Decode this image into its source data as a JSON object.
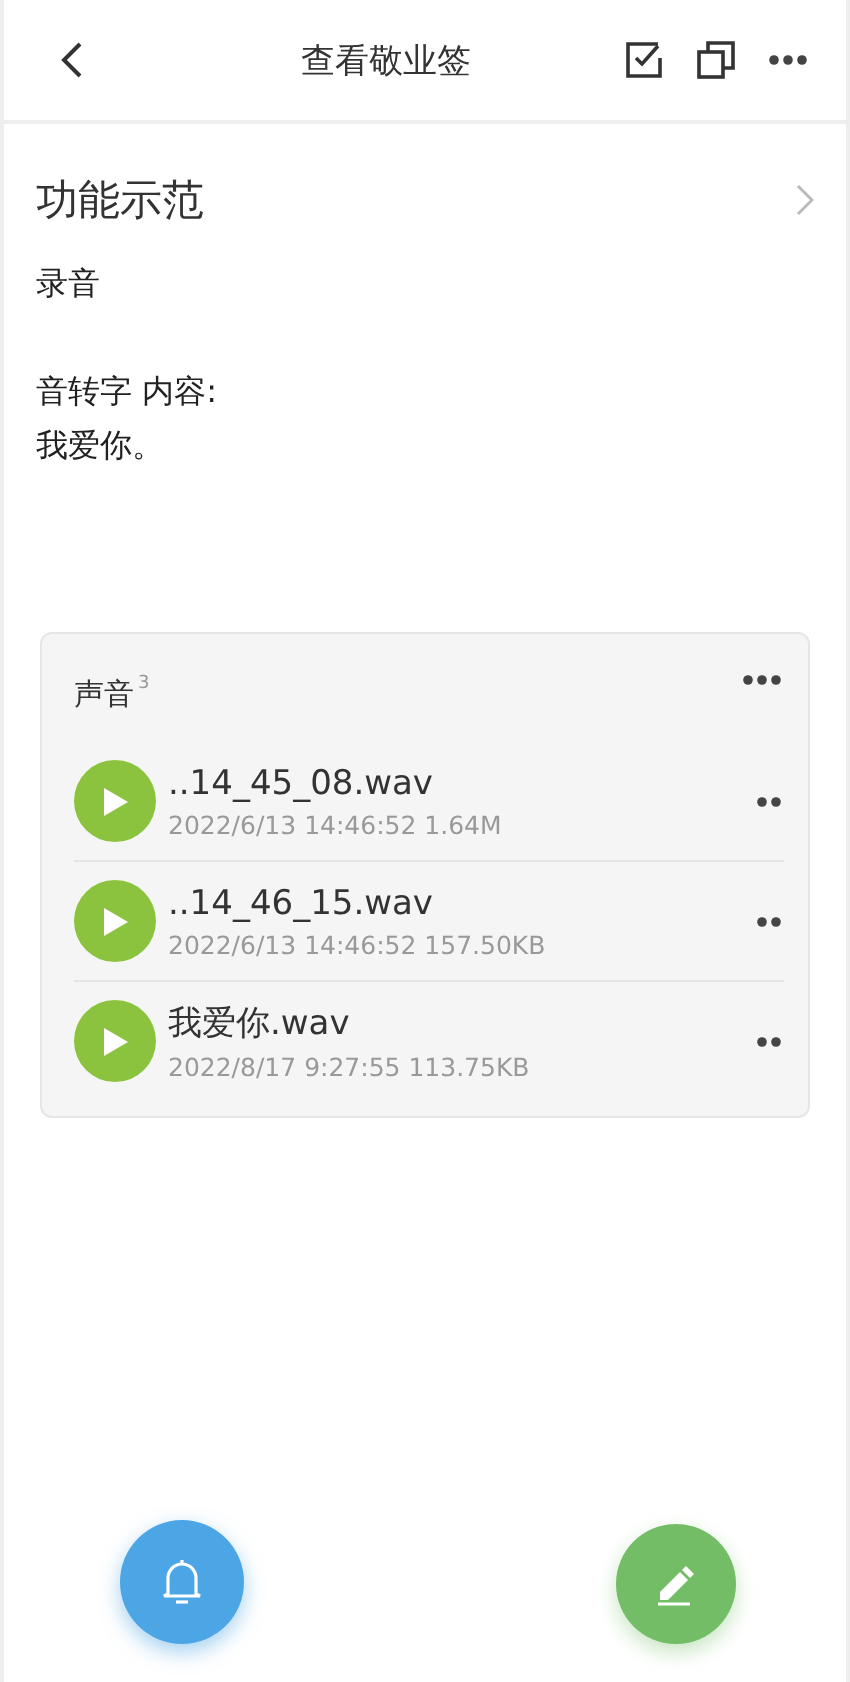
{
  "header": {
    "title": "查看敬业签"
  },
  "note": {
    "title": "功能示范",
    "paragraphs": [
      [
        "录音"
      ],
      [
        "音转字 内容:",
        "我爱你。"
      ]
    ]
  },
  "audio": {
    "title": "声音",
    "count": "3",
    "files": [
      {
        "name": "..14_45_08.wav",
        "meta": "2022/6/13 14:46:52 1.64M"
      },
      {
        "name": "..14_46_15.wav",
        "meta": "2022/6/13 14:46:52 157.50KB"
      },
      {
        "name": "我爱你.wav",
        "meta": "2022/8/17 9:27:55 113.75KB"
      }
    ]
  }
}
